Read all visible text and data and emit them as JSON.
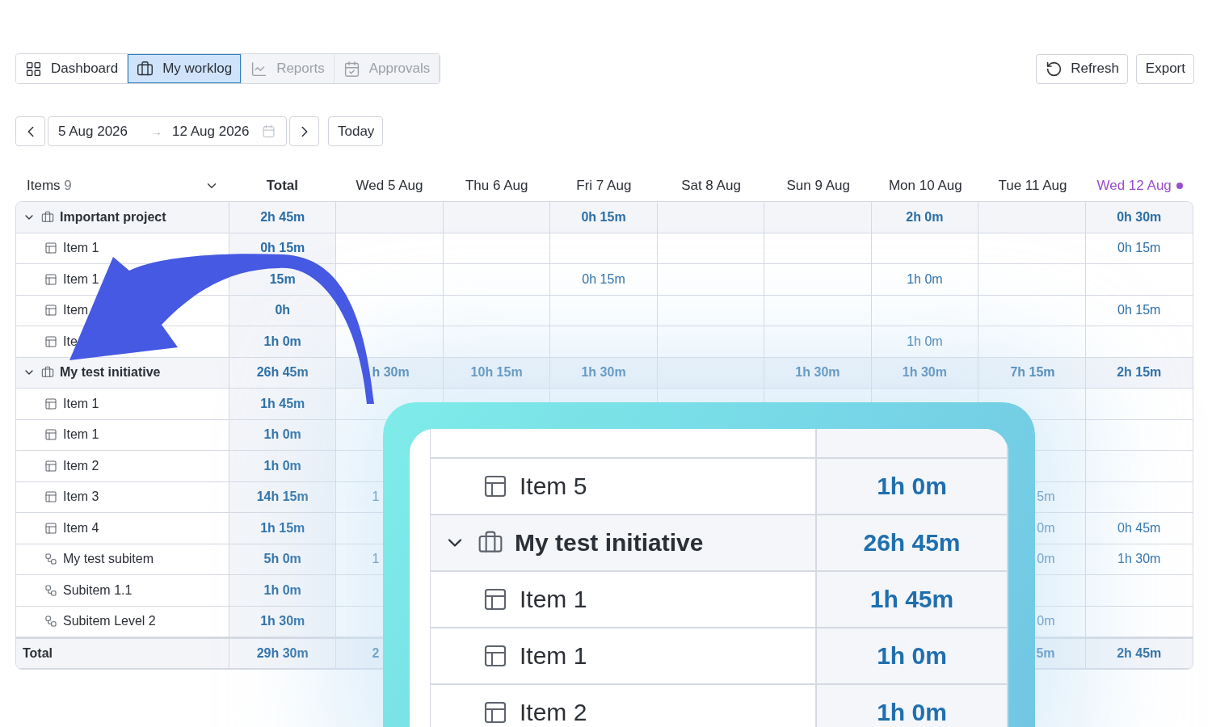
{
  "nav_tabs": [
    {
      "label": "Dashboard",
      "selected": false,
      "disabled": false
    },
    {
      "label": "My worklog",
      "selected": true,
      "disabled": false
    },
    {
      "label": "Reports",
      "selected": false,
      "disabled": true
    },
    {
      "label": "Approvals",
      "selected": false,
      "disabled": true
    }
  ],
  "actions": [
    "Refresh",
    "Export"
  ],
  "date_range": {
    "start": "5 Aug 2026",
    "separator": "→",
    "end": "12 Aug 2026"
  },
  "today_button": "Today",
  "table": {
    "items_label": "Items",
    "items_count": "9",
    "columns": [
      {
        "label": "Total",
        "today": false
      },
      {
        "label": "Wed 5 Aug",
        "today": false
      },
      {
        "label": "Thu 6 Aug",
        "today": false
      },
      {
        "label": "Fri 7 Aug",
        "today": false
      },
      {
        "label": "Sat 8 Aug",
        "today": false
      },
      {
        "label": "Sun 9 Aug",
        "today": false
      },
      {
        "label": "Mon 10 Aug",
        "today": false
      },
      {
        "label": "Tue 11 Aug",
        "today": false
      },
      {
        "label": "Wed 12 Aug",
        "today": true
      }
    ],
    "rows": [
      {
        "kind": "group",
        "name": "Important project",
        "expanded": true,
        "cells": [
          "2h 45m",
          null,
          null,
          "0h 15m",
          null,
          null,
          "2h 0m",
          null,
          "0h 30m"
        ]
      },
      {
        "kind": "item",
        "name": "Item 1",
        "cells": [
          "0h 15m",
          null,
          null,
          null,
          null,
          null,
          null,
          null,
          "0h 15m"
        ]
      },
      {
        "kind": "item",
        "name": "Item 1",
        "cells": [
          "15m",
          null,
          null,
          "0h 15m",
          null,
          null,
          "1h 0m",
          null,
          null
        ]
      },
      {
        "kind": "item",
        "name": "Item",
        "cells": [
          "0h",
          null,
          null,
          null,
          null,
          null,
          null,
          null,
          "0h 15m"
        ]
      },
      {
        "kind": "item",
        "name": "Ite",
        "cells": [
          "1h 0m",
          null,
          null,
          null,
          null,
          null,
          "1h 0m",
          null,
          null
        ]
      },
      {
        "kind": "group",
        "name": "My test initiative",
        "expanded": true,
        "cells": [
          "26h 45m",
          "h 30m",
          "10h 15m",
          "1h 30m",
          null,
          "1h 30m",
          "1h 30m",
          "7h 15m",
          "2h 15m"
        ]
      },
      {
        "kind": "item",
        "name": "Item 1",
        "cells": [
          "1h 45m",
          null,
          null,
          null,
          null,
          null,
          null,
          null,
          null
        ]
      },
      {
        "kind": "item",
        "name": "Item 1",
        "cells": [
          "1h 0m",
          null,
          null,
          null,
          null,
          null,
          null,
          null,
          null
        ]
      },
      {
        "kind": "item",
        "name": "Item 2",
        "cells": [
          "1h 0m",
          null,
          null,
          null,
          null,
          null,
          null,
          null,
          null
        ]
      },
      {
        "kind": "item",
        "name": "Item 3",
        "cells": [
          "14h 15m",
          "1",
          null,
          null,
          null,
          null,
          null,
          "5m",
          null
        ]
      },
      {
        "kind": "item",
        "name": "Item 4",
        "cells": [
          "1h 15m",
          null,
          null,
          null,
          null,
          null,
          null,
          "0m",
          "0h 45m"
        ]
      },
      {
        "kind": "subitem",
        "name": "My test subitem",
        "cells": [
          "5h 0m",
          "1",
          null,
          null,
          null,
          null,
          null,
          "0m",
          "1h 30m"
        ]
      },
      {
        "kind": "subitem",
        "name": "Subitem 1.1",
        "cells": [
          "1h 0m",
          null,
          null,
          null,
          null,
          null,
          null,
          null,
          null
        ]
      },
      {
        "kind": "subitem",
        "name": "Subitem Level 2",
        "cells": [
          "1h 30m",
          null,
          null,
          null,
          null,
          null,
          null,
          "0m",
          null
        ]
      },
      {
        "kind": "total",
        "name": "Total",
        "cells": [
          "29h 30m",
          "2",
          null,
          null,
          null,
          null,
          null,
          "5m",
          "2h 45m"
        ]
      }
    ]
  },
  "callout": {
    "rows": [
      {
        "kind": "item",
        "name": "Item 5",
        "total": "1h 0m"
      },
      {
        "kind": "group",
        "name": "My test initiative",
        "expanded": true,
        "total": "26h 45m"
      },
      {
        "kind": "item",
        "name": "Item 1",
        "total": "1h 45m"
      },
      {
        "kind": "item",
        "name": "Item 1",
        "total": "1h 0m"
      },
      {
        "kind": "item",
        "name": "Item 2",
        "total": "1h 0m"
      }
    ]
  }
}
